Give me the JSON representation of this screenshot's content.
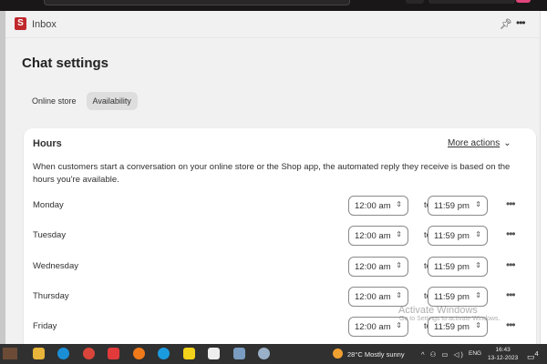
{
  "app": {
    "title": "Inbox",
    "logo_letter": "S"
  },
  "page": {
    "title": "Chat settings"
  },
  "tabs": [
    {
      "label": "Online store",
      "active": false
    },
    {
      "label": "Availability",
      "active": true
    }
  ],
  "hours": {
    "title": "Hours",
    "more_actions": "More actions",
    "description": "When customers start a conversation on your online store or the Shop app, the automated reply they receive is based on the hours you're available.",
    "to_label": "to",
    "days": [
      {
        "day": "Monday",
        "start": "12:00 am",
        "end": "11:59 pm"
      },
      {
        "day": "Tuesday",
        "start": "12:00 am",
        "end": "11:59 pm"
      },
      {
        "day": "Wednesday",
        "start": "12:00 am",
        "end": "11:59 pm"
      },
      {
        "day": "Thursday",
        "start": "12:00 am",
        "end": "11:59 pm"
      },
      {
        "day": "Friday",
        "start": "12:00 am",
        "end": "11:59 pm"
      }
    ]
  },
  "watermark": {
    "title": "Activate Windows",
    "subtitle": "Go to Settings to activate Windows."
  },
  "taskbar": {
    "weather": "28°C  Mostly sunny",
    "lang": "ENG",
    "time": "16:43",
    "date": "13-12-2023",
    "notifications": "4"
  }
}
